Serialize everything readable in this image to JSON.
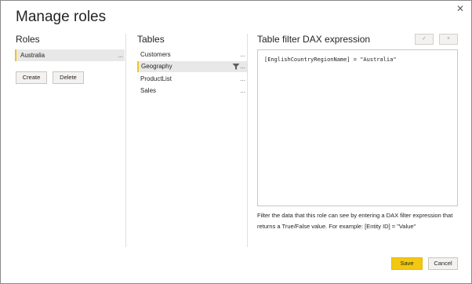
{
  "dialog": {
    "title": "Manage roles",
    "close_glyph": "✕"
  },
  "roles": {
    "heading": "Roles",
    "items": [
      {
        "label": "Australia",
        "more": "..."
      }
    ],
    "create_label": "Create",
    "delete_label": "Delete"
  },
  "tables": {
    "heading": "Tables",
    "items": [
      {
        "label": "Customers",
        "more": "...",
        "selected": false,
        "filtered": false
      },
      {
        "label": "Geography",
        "more": "...",
        "selected": true,
        "filtered": true
      },
      {
        "label": "ProductList",
        "more": "...",
        "selected": false,
        "filtered": false
      },
      {
        "label": "Sales",
        "more": "...",
        "selected": false,
        "filtered": false
      }
    ]
  },
  "expression": {
    "heading": "Table filter DAX expression",
    "confirm_glyph": "✓",
    "cancel_glyph": "×",
    "dax": "[EnglishCountryRegionName] = \"Australia\"",
    "help_text": "Filter the data that this role can see by entering a DAX filter expression that returns a True/False value. For example: [Entity ID] = \"Value\""
  },
  "footer": {
    "save_label": "Save",
    "cancel_label": "Cancel"
  },
  "colors": {
    "accent": "#f2c811",
    "selected_bg": "#e8e8e8",
    "border": "#c8c6c4"
  },
  "icons": {
    "close": "close-icon",
    "filter": "filter-icon",
    "confirm": "checkmark-icon",
    "discard": "x-icon"
  }
}
